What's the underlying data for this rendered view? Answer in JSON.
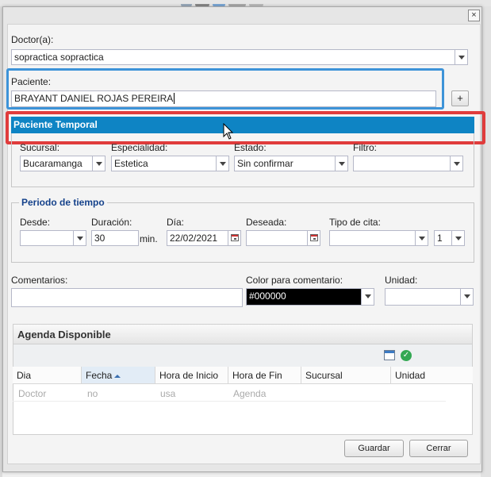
{
  "window": {
    "close_glyph": "×"
  },
  "doctor": {
    "label": "Doctor(a):",
    "value": "sopractica sopractica"
  },
  "paciente": {
    "label": "Paciente:",
    "value": "BRAYANT DANIEL ROJAS PEREIRA",
    "add_label": "+"
  },
  "paciente_temporal": {
    "title": "Paciente Temporal"
  },
  "filters": {
    "sucursal": {
      "label": "Sucursal:",
      "value": "Bucaramanga"
    },
    "especialidad": {
      "label": "Especialidad:",
      "value": "Estetica"
    },
    "estado": {
      "label": "Estado:",
      "value": "Sin confirmar"
    },
    "filtro": {
      "label": "Filtro:",
      "value": ""
    }
  },
  "periodo": {
    "legend": "Periodo de tiempo",
    "desde": {
      "label": "Desde:",
      "value": ""
    },
    "duracion": {
      "label": "Duración:",
      "value": "30",
      "unit": "min."
    },
    "dia": {
      "label": "Día:",
      "value": "22/02/2021"
    },
    "deseada": {
      "label": "Deseada:",
      "value": ""
    },
    "tipo_cita": {
      "label": "Tipo de cita:",
      "value": "",
      "count": "1"
    }
  },
  "comentarios": {
    "label": "Comentarios:",
    "value": "",
    "color_label": "Color para comentario:",
    "color_value": "#000000",
    "unidad_label": "Unidad:",
    "unidad_value": ""
  },
  "agenda": {
    "title": "Agenda Disponible",
    "columns": [
      "Dia",
      "Fecha",
      "Hora de Inicio",
      "Hora de Fin",
      "Sucursal",
      "Unidad"
    ],
    "row": [
      "Doctor",
      "no",
      "usa",
      "Agenda"
    ]
  },
  "footer": {
    "save_label": "Guardar",
    "close_label": "Cerrar"
  },
  "colors": {
    "accent_blue": "#0e84c4",
    "highlight_blue": "#3d93d8",
    "highlight_red": "#e03c3c",
    "legend_blue": "#15428b"
  }
}
